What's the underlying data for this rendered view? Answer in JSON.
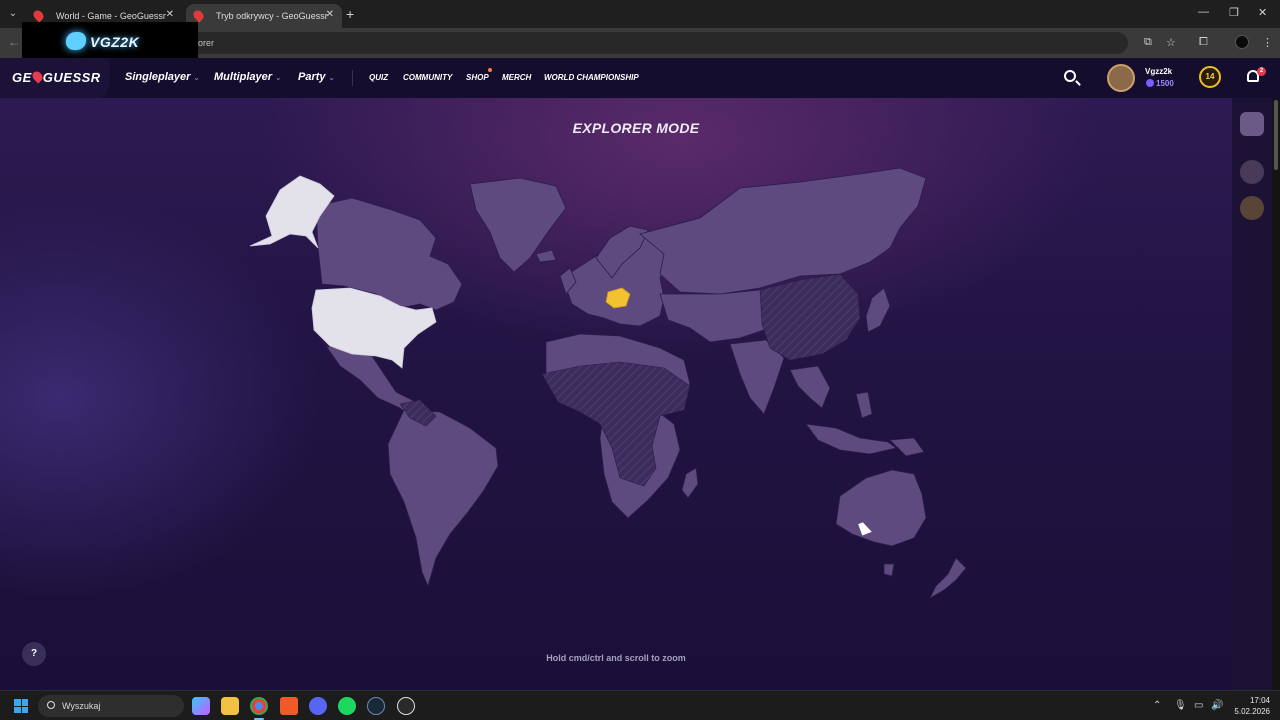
{
  "browser": {
    "tabs": [
      {
        "title": "World - Game - GeoGuessr",
        "active": false
      },
      {
        "title": "Tryb odkrywcy - GeoGuessr",
        "active": true
      }
    ],
    "url_visible": "orer",
    "overlay_text": "VGZ2K"
  },
  "header": {
    "logo": {
      "left": "GE",
      "right": "GUESSR"
    },
    "nav": [
      {
        "label": "Singleplayer"
      },
      {
        "label": "Multiplayer"
      },
      {
        "label": "Party"
      }
    ],
    "subnav": [
      {
        "label": "Quiz"
      },
      {
        "label": "Community"
      },
      {
        "label": "Shop"
      },
      {
        "label": "Merch"
      },
      {
        "label": "World Championship"
      }
    ],
    "user": {
      "name": "Vgzz2k",
      "coins": "1500",
      "level": "14",
      "notifications": "2"
    }
  },
  "main": {
    "title": "EXPLORER MODE",
    "zoom_hint": "Hold cmd/ctrl and scroll to zoom",
    "help_label": "?",
    "map_colors": {
      "land": "#5e4a7e",
      "visited_complete": "#e2e2ea",
      "selected": "#f2c230",
      "unavailable_hatch": "#4a3868"
    }
  },
  "taskbar": {
    "search_placeholder": "Wyszukaj",
    "time": "17:04",
    "date": "5.02.2026"
  }
}
